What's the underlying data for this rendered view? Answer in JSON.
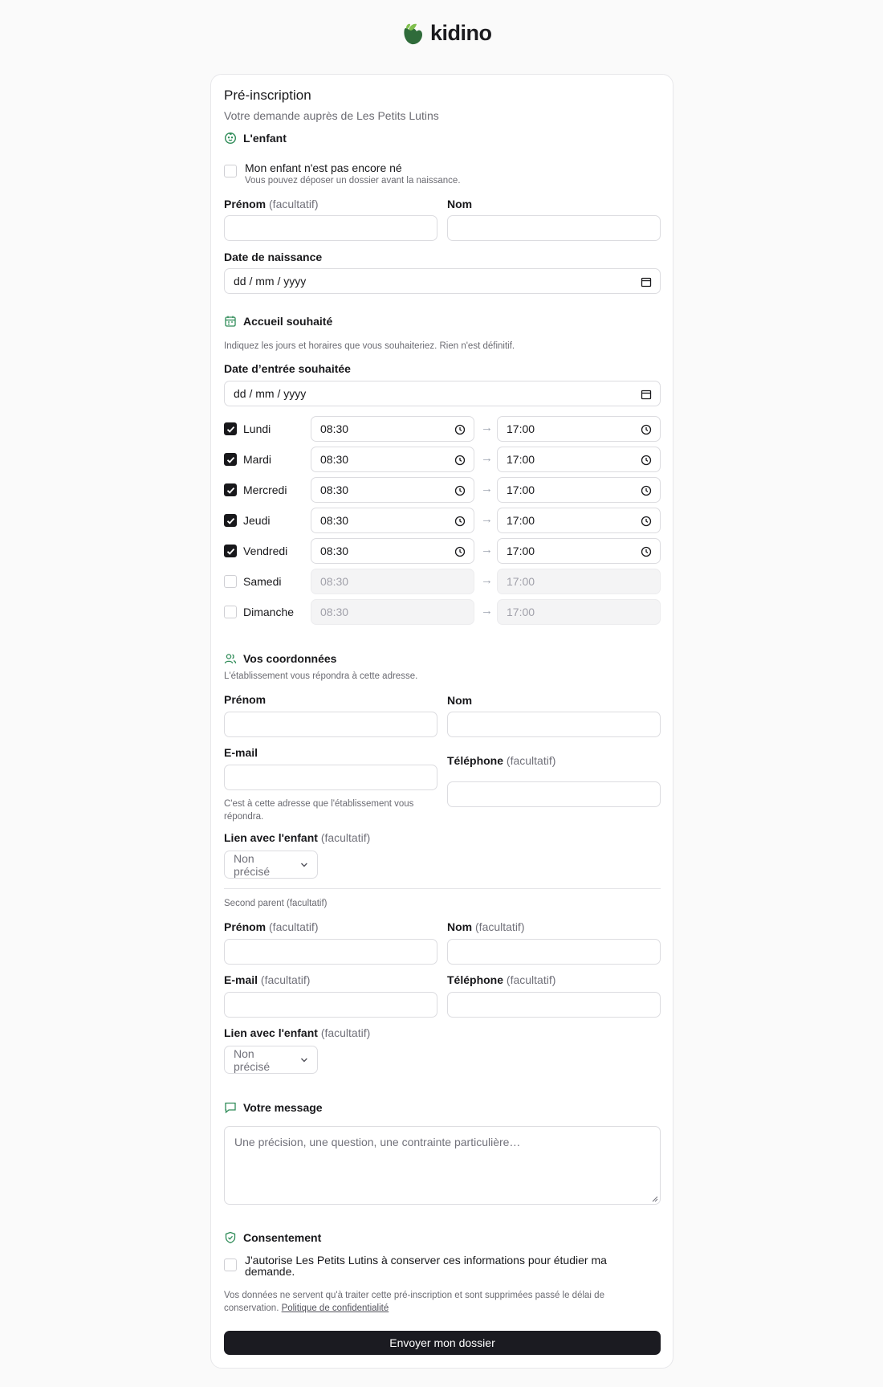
{
  "brand": {
    "name": "kidino"
  },
  "form": {
    "title": "Pré-inscription",
    "subtitle": "Votre demande auprès de Les Petits Lutins"
  },
  "child": {
    "heading": "L'enfant",
    "not_born": {
      "label": "Mon enfant n'est pas encore né",
      "hint": "Vous pouvez déposer un dossier avant la naissance.",
      "checked": false
    },
    "first_name_label": "Prénom",
    "first_name_optional": "(facultatif)",
    "last_name_label": "Nom",
    "birth_date_label": "Date de naissance",
    "birth_date_value": "dd / mm / yyyy"
  },
  "schedule": {
    "heading": "Accueil souhaité",
    "hint": "Indiquez les jours et horaires que vous souhaiteriez. Rien n'est définitif.",
    "start_date_label": "Date d’entrée souhaitée",
    "start_date_value": "dd / mm / yyyy",
    "arrow": "→",
    "days": [
      {
        "label": "Lundi",
        "checked": true,
        "from": "08:30",
        "to": "17:00"
      },
      {
        "label": "Mardi",
        "checked": true,
        "from": "08:30",
        "to": "17:00"
      },
      {
        "label": "Mercredi",
        "checked": true,
        "from": "08:30",
        "to": "17:00"
      },
      {
        "label": "Jeudi",
        "checked": true,
        "from": "08:30",
        "to": "17:00"
      },
      {
        "label": "Vendredi",
        "checked": true,
        "from": "08:30",
        "to": "17:00"
      },
      {
        "label": "Samedi",
        "checked": false,
        "from": "08:30",
        "to": "17:00"
      },
      {
        "label": "Dimanche",
        "checked": false,
        "from": "08:30",
        "to": "17:00"
      }
    ]
  },
  "contact": {
    "heading": "Vos coordonnées",
    "hint": "L'établissement vous répondra à cette adresse.",
    "first_name_label": "Prénom",
    "last_name_label": "Nom",
    "email_label": "E-mail",
    "email_hint_line1": "C'est à cette adresse que l'établissement vous",
    "email_hint_line2": "répondra.",
    "phone_label": "Téléphone",
    "optional": "(facultatif)",
    "relation_label": "Lien avec l'enfant",
    "relation_value": "Non précisé"
  },
  "second_parent": {
    "heading": "Second parent (facultatif)",
    "first_name_label": "Prénom",
    "last_name_label": "Nom",
    "email_label": "E-mail",
    "phone_label": "Téléphone",
    "optional": "(facultatif)",
    "relation_label": "Lien avec l'enfant",
    "relation_value": "Non précisé"
  },
  "message": {
    "heading": "Votre message",
    "placeholder": "Une précision, une question, une contrainte particulière…"
  },
  "consent": {
    "heading": "Consentement",
    "checkbox_line1": "J'autorise Les Petits Lutins à conserver ces informations pour étudier ma",
    "checkbox_line2": "demande.",
    "checked": false,
    "notice_line1": "Vos données ne servent qu'à traiter cette pré-inscription et sont supprimées passé le délai de",
    "notice_line2_prefix": "conservation.",
    "privacy_link": "Politique de confidentialité"
  },
  "submit_label": "Envoyer mon dossier",
  "colors": {
    "accent": "#2e8b57",
    "button": "#1b1b21"
  }
}
